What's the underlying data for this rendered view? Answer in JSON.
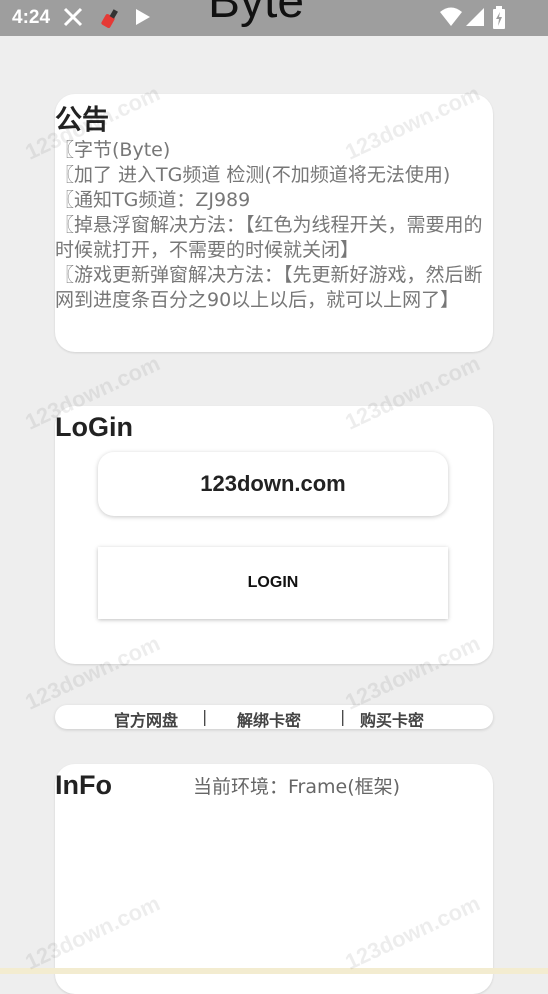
{
  "status_bar": {
    "time": "4:24",
    "icons": [
      "x-icon",
      "app-icon",
      "play-icon",
      "wifi-icon",
      "signal-icon",
      "battery-icon"
    ]
  },
  "app": {
    "title": "Byte"
  },
  "notice": {
    "title": "公告",
    "lines": [
      "〖字节(Byte)",
      "〖加了 进入TG频道 检测(不加频道将无法使用)",
      "〖通知TG频道：ZJ989",
      "〖掉悬浮窗解决方法：【红色为线程开关，需要用的时候就打开，不需要的时候就关闭】",
      "〖游戏更新弹窗解决方法：【先更新好游戏，然后断网到进度条百分之90以上以后，就可以上网了】"
    ]
  },
  "login": {
    "title": "LoGin",
    "key_value": "123down.com",
    "button": "LOGIN"
  },
  "links": {
    "item1": "官方网盘",
    "sep": "|",
    "item2": "解绑卡密",
    "item3": "购买卡密"
  },
  "info": {
    "title": "InFo",
    "env": "当前环境：Frame(框架)"
  },
  "watermark": "123down.com",
  "colors": {
    "statusbar": "#9e9e9e",
    "background": "#eeeeee",
    "card": "#ffffff"
  }
}
